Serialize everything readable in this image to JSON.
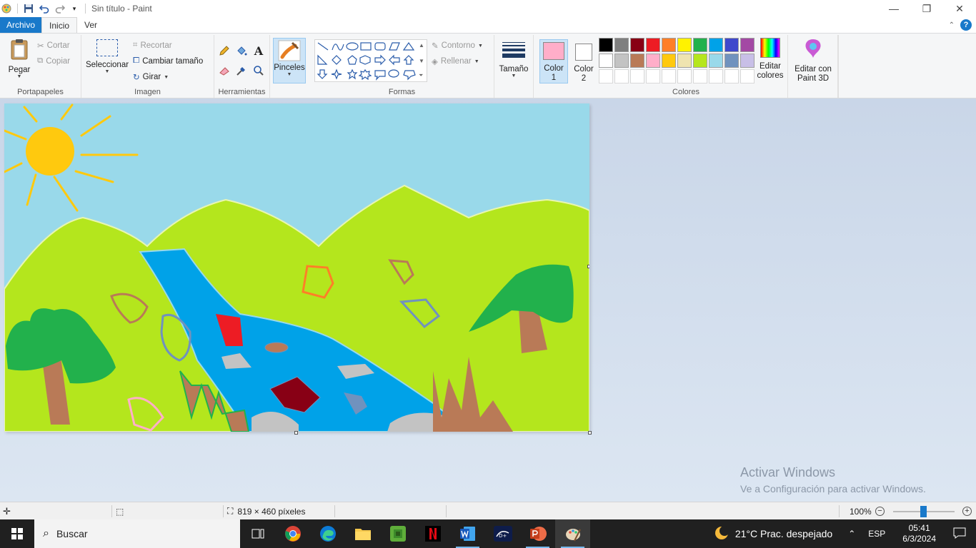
{
  "window": {
    "title": "Sin título - Paint"
  },
  "tabs": {
    "file": "Archivo",
    "home": "Inicio",
    "view": "Ver"
  },
  "clipboard": {
    "paste": "Pegar",
    "cut": "Cortar",
    "copy": "Copiar",
    "label": "Portapapeles"
  },
  "image": {
    "select": "Seleccionar",
    "crop": "Recortar",
    "resize": "Cambiar tamaño",
    "rotate": "Girar",
    "label": "Imagen"
  },
  "tools": {
    "label": "Herramientas"
  },
  "brushes": {
    "label": "Pinceles"
  },
  "shapes": {
    "outline": "Contorno",
    "fill": "Rellenar",
    "label": "Formas"
  },
  "size": {
    "label": "Tamaño"
  },
  "colors": {
    "color1_label_a": "Color",
    "color1_label_b": "1",
    "color2_label_a": "Color",
    "color2_label_b": "2",
    "color1": "#ffaec9",
    "color2": "#ffffff",
    "edit": "Editar",
    "edit_b": "colores",
    "paint3d": "Editar con",
    "paint3d_b": "Paint 3D",
    "label": "Colores",
    "palette": [
      "#000000",
      "#7f7f7f",
      "#880015",
      "#ed1c24",
      "#ff7f27",
      "#fff200",
      "#22b14c",
      "#00a2e8",
      "#3f48cc",
      "#a349a4",
      "#ffffff",
      "#c3c3c3",
      "#b97a57",
      "#ffaec9",
      "#ffc90e",
      "#efe4b0",
      "#b5e61d",
      "#99d9ea",
      "#7092be",
      "#c8bfe7"
    ]
  },
  "watermark": {
    "title": "Activar Windows",
    "subtitle": "Ve a Configuración para activar Windows."
  },
  "status": {
    "dimensions": "819 × 460 píxeles",
    "zoom": "100%"
  },
  "taskbar": {
    "search": "Buscar",
    "weather": "21°C  Prac. despejado",
    "lang": "ESP",
    "time": "05:41",
    "date": "6/3/2024"
  }
}
